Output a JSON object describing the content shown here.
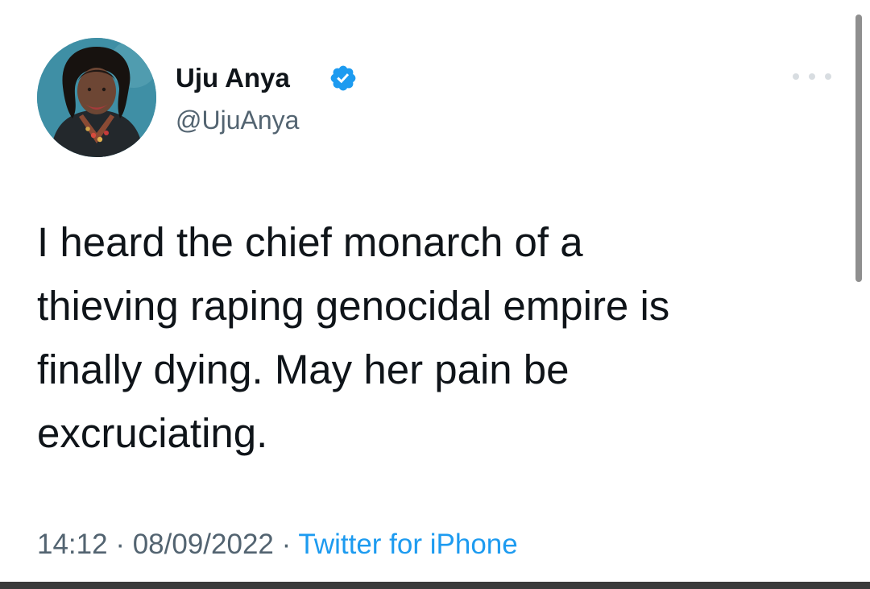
{
  "author": {
    "display_name": "Uju Anya",
    "handle": "@UjuAnya",
    "verified_icon": "verified-badge-icon",
    "avatar_icon": "profile-photo"
  },
  "menu": {
    "more_icon": "more-horizontal-icon"
  },
  "tweet": {
    "lines": [
      "I heard the chief monarch of a",
      "thieving raping genocidal empire is",
      "finally dying. May her pain be",
      "excruciating."
    ]
  },
  "meta": {
    "time": "14:12",
    "separator": "·",
    "date": "08/09/2022",
    "source": "Twitter for iPhone"
  },
  "colors": {
    "accent": "#1d9bf0",
    "text_primary": "#0f1419",
    "text_secondary": "#536471",
    "scrollbar": "#8f8f8f",
    "bottom_bar": "#3a3a3a"
  }
}
